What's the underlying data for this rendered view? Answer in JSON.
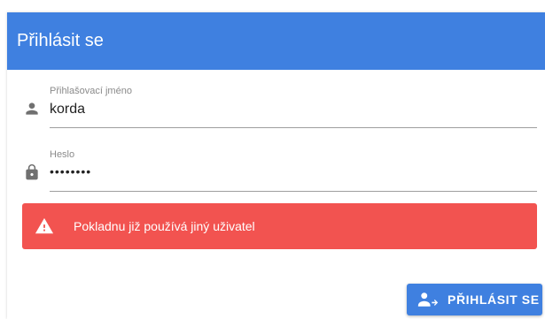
{
  "header": {
    "title": "Přihlásit se"
  },
  "form": {
    "username": {
      "label": "Přihlašovací jméno",
      "value": "korda",
      "icon": "person-icon"
    },
    "password": {
      "label": "Heslo",
      "value": "••••••••",
      "icon": "lock-icon"
    }
  },
  "alert": {
    "text": "Pokladnu již používá jiný uživatel",
    "icon": "warning-icon",
    "color": "#f25350"
  },
  "login_button": {
    "label": "PŘIHLÁSIT SE",
    "icon": "login-user-icon"
  },
  "colors": {
    "primary": "#3f80e0",
    "error": "#f25350"
  }
}
